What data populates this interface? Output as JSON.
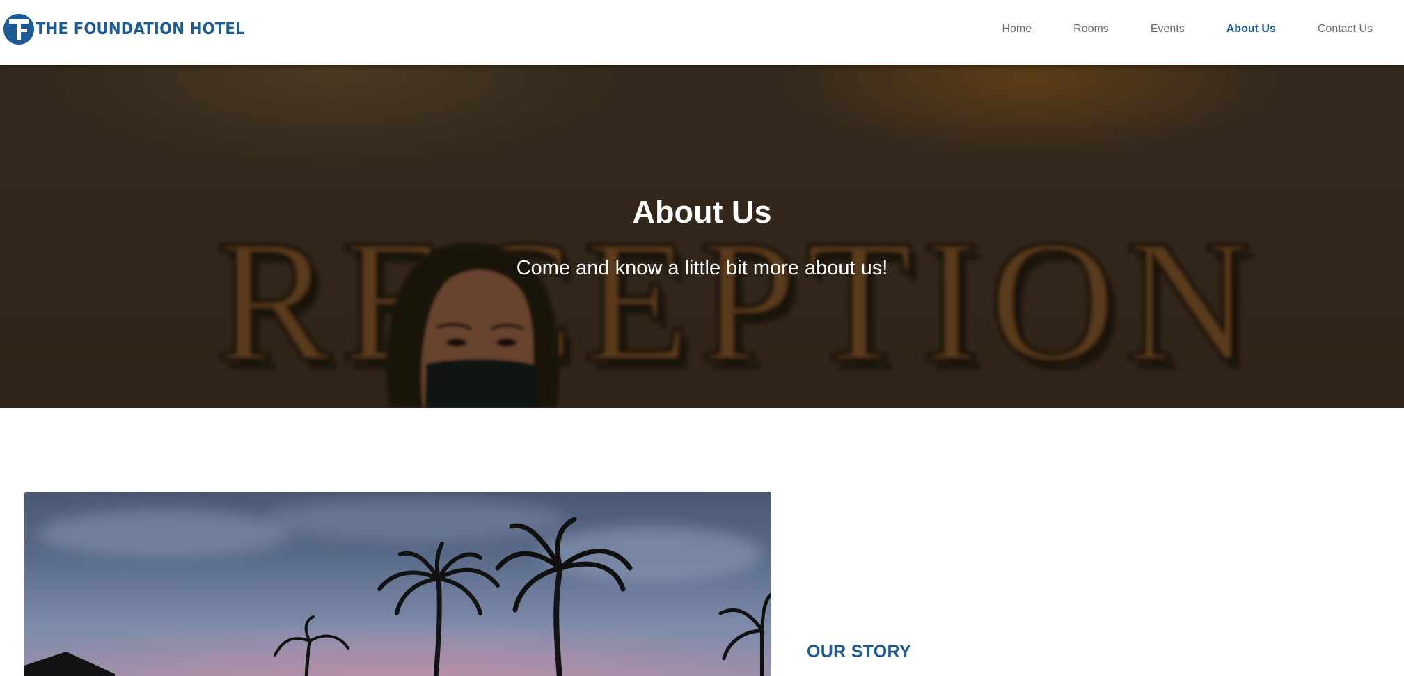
{
  "brand": {
    "name": "THE FOUNDATION HOTEL",
    "logo_icon": "foundation-hotel-logo-icon",
    "color": "#1c5a96"
  },
  "nav": {
    "items": [
      {
        "label": "Home",
        "active": false
      },
      {
        "label": "Rooms",
        "active": false
      },
      {
        "label": "Events",
        "active": false
      },
      {
        "label": "About Us",
        "active": true
      },
      {
        "label": "Contact Us",
        "active": false
      }
    ],
    "active_color": "#1c5a96",
    "inactive_color": "#6b6b6b"
  },
  "hero": {
    "title": "About Us",
    "subtitle": "Come and know a little bit more about us!",
    "background_sign_text": "RECEPTION"
  },
  "story": {
    "heading": "OUR STORY",
    "image": "palm-trees-at-dusk-image"
  }
}
